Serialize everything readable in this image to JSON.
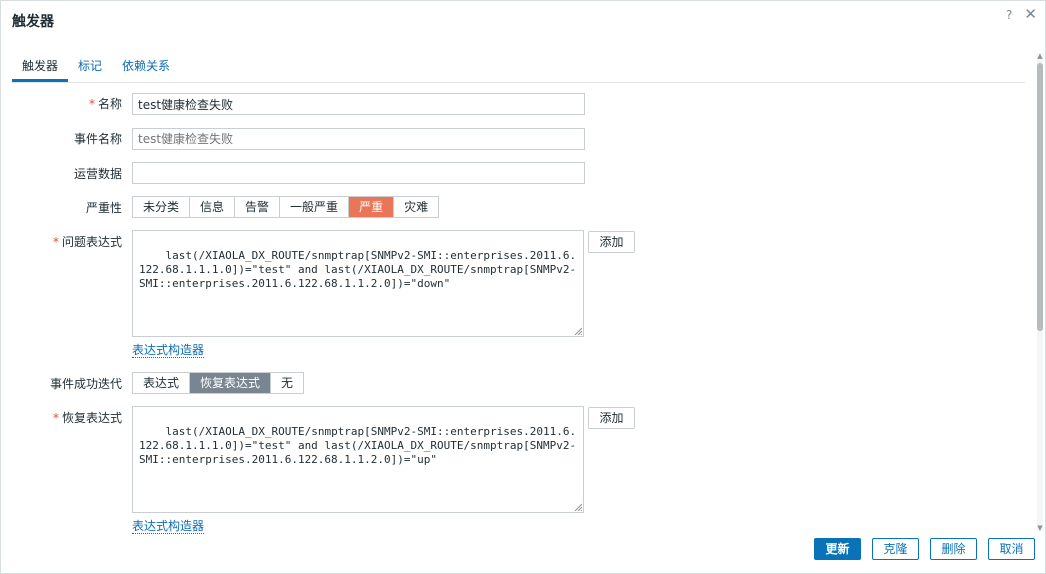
{
  "dialog": {
    "title": "触发器",
    "help_icon": "?",
    "close_icon": "✕"
  },
  "tabs": [
    {
      "label": "触发器",
      "active": true
    },
    {
      "label": "标记",
      "active": false
    },
    {
      "label": "依赖关系",
      "active": false
    }
  ],
  "form": {
    "name": {
      "label": "名称",
      "required": true,
      "value": "test健康检查失败"
    },
    "event_name": {
      "label": "事件名称",
      "value": "",
      "placeholder": "test健康检查失败"
    },
    "opdata": {
      "label": "运营数据",
      "value": ""
    },
    "severity": {
      "label": "严重性",
      "options": [
        "未分类",
        "信息",
        "告警",
        "一般严重",
        "严重",
        "灾难"
      ],
      "selected": "严重",
      "selected_color": "#e97659"
    },
    "problem_expr": {
      "label": "问题表达式",
      "required": true,
      "value": "last(/XIAOLA_DX_ROUTE/snmptrap[SNMPv2-SMI::enterprises.2011.6.122.68.1.1.1.0])=\"test\" and last(/XIAOLA_DX_ROUTE/snmptrap[SNMPv2-SMI::enterprises.2011.6.122.68.1.1.2.0])=\"down\"",
      "add_label": "添加",
      "builder_link": "表达式构造器"
    },
    "ok_event": {
      "label": "事件成功迭代",
      "options": [
        "表达式",
        "恢复表达式",
        "无"
      ],
      "selected": "恢复表达式"
    },
    "recovery_expr": {
      "label": "恢复表达式",
      "required": true,
      "value": "last(/XIAOLA_DX_ROUTE/snmptrap[SNMPv2-SMI::enterprises.2011.6.122.68.1.1.1.0])=\"test\" and last(/XIAOLA_DX_ROUTE/snmptrap[SNMPv2-SMI::enterprises.2011.6.122.68.1.1.2.0])=\"up\"",
      "add_label": "添加",
      "builder_link": "表达式构造器"
    }
  },
  "footer": {
    "update": "更新",
    "clone": "克隆",
    "delete": "删除",
    "cancel": "取消"
  },
  "colors": {
    "accent": "#0a73b7",
    "severity_high": "#e97659",
    "segment_active": "#798591",
    "required_mark": "#e04e35"
  }
}
